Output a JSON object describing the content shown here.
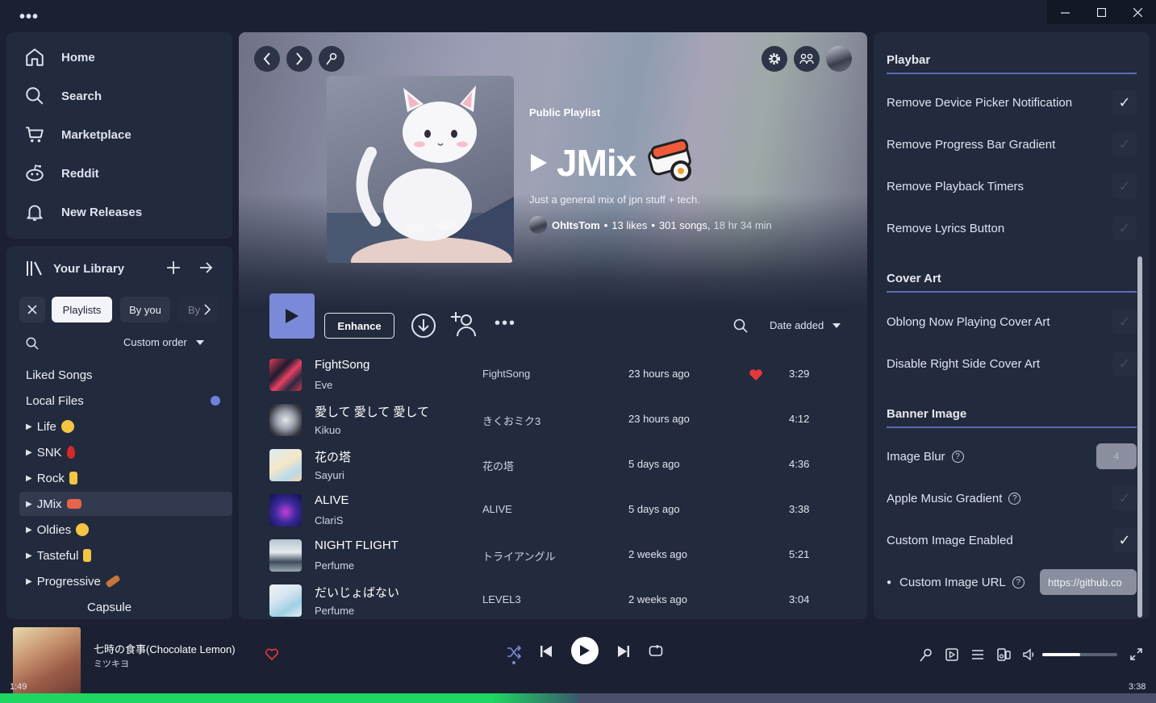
{
  "titlebar": {
    "menu_dots": "•••"
  },
  "nav": {
    "items": [
      {
        "label": "Home",
        "icon": "home-icon"
      },
      {
        "label": "Search",
        "icon": "search-icon"
      },
      {
        "label": "Marketplace",
        "icon": "cart-icon"
      },
      {
        "label": "Reddit",
        "icon": "reddit-icon"
      },
      {
        "label": "New Releases",
        "icon": "bell-icon"
      }
    ]
  },
  "library": {
    "title": "Your Library",
    "chips": {
      "playlists": "Playlists",
      "by_you": "By you",
      "by_more": "By"
    },
    "sort_label": "Custom order",
    "items": [
      {
        "label": "Liked Songs"
      },
      {
        "label": "Local Files"
      },
      {
        "label": "Life"
      },
      {
        "label": "SNK"
      },
      {
        "label": "Rock"
      },
      {
        "label": "JMix"
      },
      {
        "label": "Oldies"
      },
      {
        "label": "Tasteful"
      },
      {
        "label": "Progressive"
      },
      {
        "label": "Capsule"
      }
    ]
  },
  "playlist": {
    "type": "Public Playlist",
    "title": "JMix",
    "description": "Just a general mix of jpn stuff + tech.",
    "owner": "OhItsTom",
    "likes": "13 likes",
    "songs": "301 songs,",
    "duration": "18 hr 34 min",
    "enhance_label": "Enhance",
    "sort_label": "Date added"
  },
  "tracks": [
    {
      "title": "FightSong",
      "artist": "Eve",
      "album": "FightSong",
      "added": "23 hours ago",
      "duration": "3:29",
      "liked": true
    },
    {
      "title": "愛して 愛して 愛して",
      "artist": "Kikuo",
      "album": "きくおミク3",
      "added": "23 hours ago",
      "duration": "4:12",
      "liked": false
    },
    {
      "title": "花の塔",
      "artist": "Sayuri",
      "album": "花の塔",
      "added": "5 days ago",
      "duration": "4:36",
      "liked": false
    },
    {
      "title": "ALIVE",
      "artist": "ClariS",
      "album": "ALIVE",
      "added": "5 days ago",
      "duration": "3:38",
      "liked": false
    },
    {
      "title": "NIGHT FLIGHT",
      "artist": "Perfume",
      "album": "トライアングル",
      "added": "2 weeks ago",
      "duration": "5:21",
      "liked": false
    },
    {
      "title": "だいじょばない",
      "artist": "Perfume",
      "album": "LEVEL3",
      "added": "2 weeks ago",
      "duration": "3:04",
      "liked": false
    }
  ],
  "settings": {
    "sections": [
      {
        "title": "Playbar",
        "options": [
          {
            "label": "Remove Device Picker Notification",
            "checked": true
          },
          {
            "label": "Remove Progress Bar Gradient",
            "checked": false
          },
          {
            "label": "Remove Playback Timers",
            "checked": false
          },
          {
            "label": "Remove Lyrics Button",
            "checked": false
          }
        ]
      },
      {
        "title": "Cover Art",
        "options": [
          {
            "label": "Oblong Now Playing Cover Art",
            "checked": false
          },
          {
            "label": "Disable Right Side Cover Art",
            "checked": false
          }
        ]
      },
      {
        "title": "Banner Image",
        "options": [
          {
            "label": "Image Blur",
            "type": "number",
            "value": "4"
          },
          {
            "label": "Apple Music Gradient",
            "checked": false
          },
          {
            "label": "Custom Image Enabled",
            "checked": true
          },
          {
            "label": "Custom Image URL",
            "type": "text",
            "value": "https://github.co"
          }
        ]
      }
    ]
  },
  "now_playing": {
    "title": "七時の食事(Chocolate Lemon)",
    "artist": "ミツキヨ",
    "elapsed": "1:49",
    "total": "3:38",
    "progress": 0.5,
    "volume": 0.5
  },
  "colors": {
    "accent": "#7b8ad8",
    "like": "#e5383b",
    "progress": "#1ed760"
  }
}
